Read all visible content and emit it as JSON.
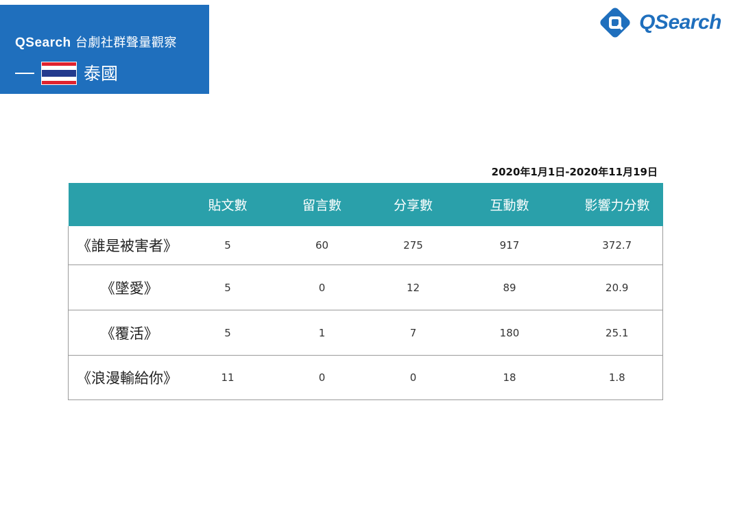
{
  "banner": {
    "brand": "QSearch",
    "subtitle": "台劇社群聲量觀察",
    "country": "泰國",
    "flag_colors": {
      "red": "#e0232f",
      "white": "#ffffff",
      "blue": "#233a8e"
    },
    "background": "#1f6fbd"
  },
  "logo": {
    "text": "QSearch",
    "color": "#1f6fbd"
  },
  "date_range": "2020年1月1日-2020年11月19日",
  "table": {
    "header_color": "#2aa0aa",
    "columns": [
      "",
      "貼文數",
      "留言數",
      "分享數",
      "互動數",
      "影響力分數"
    ],
    "rows": [
      {
        "show": "《誰是被害者》",
        "posts": "5",
        "comments": "60",
        "shares": "275",
        "interactions": "917",
        "influence": "372.7"
      },
      {
        "show": "《墜愛》",
        "posts": "5",
        "comments": "0",
        "shares": "12",
        "interactions": "89",
        "influence": "20.9"
      },
      {
        "show": "《覆活》",
        "posts": "5",
        "comments": "1",
        "shares": "7",
        "interactions": "180",
        "influence": "25.1"
      },
      {
        "show": "《浪漫輸給你》",
        "posts": "11",
        "comments": "0",
        "shares": "0",
        "interactions": "18",
        "influence": "1.8"
      }
    ]
  }
}
